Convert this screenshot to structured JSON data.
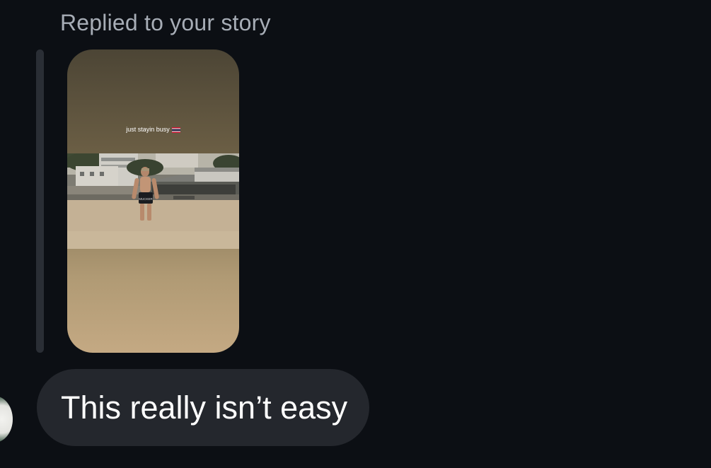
{
  "reply_context": {
    "label": "Replied to your story"
  },
  "story": {
    "caption": "just stayin busy",
    "caption_flag_icon": "thailand-flag-icon",
    "shorts_text": "MUCKER"
  },
  "message": {
    "text": "This really isn’t easy"
  },
  "colors": {
    "background": "#0c0f14",
    "bubble": "#24272d",
    "label": "#a7adb6",
    "reply_bar": "#2a2e35"
  }
}
